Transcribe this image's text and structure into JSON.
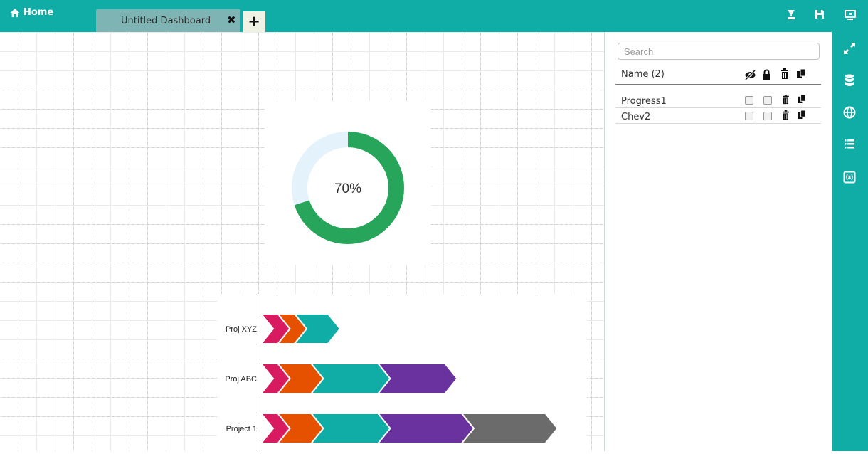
{
  "topbar": {
    "home_label": "Home",
    "tab_title": "Untitled Dashboard",
    "tab_close": "✖",
    "tab_add": "+",
    "color": "#10ada6"
  },
  "progress_widget": {
    "percent_label": "70%",
    "value": 0.7,
    "fill_color": "#27a55a",
    "track_color": "#e3f2fb"
  },
  "chevron_widget": {
    "rows": [
      {
        "label": "Proj XYZ",
        "segments": [
          {
            "color": "#d81b60",
            "size": 1
          },
          {
            "color": "#e65100",
            "size": 1
          },
          {
            "color": "#10ada6",
            "size": 2
          }
        ]
      },
      {
        "label": "Proj ABC",
        "segments": [
          {
            "color": "#d81b60",
            "size": 1
          },
          {
            "color": "#e65100",
            "size": 2
          },
          {
            "color": "#10ada6",
            "size": 4
          },
          {
            "color": "#6a329f",
            "size": 4
          }
        ]
      },
      {
        "label": "Project 1",
        "segments": [
          {
            "color": "#d81b60",
            "size": 1
          },
          {
            "color": "#e65100",
            "size": 2
          },
          {
            "color": "#10ada6",
            "size": 4
          },
          {
            "color": "#6a329f",
            "size": 5
          },
          {
            "color": "#6b6b6b",
            "size": 5
          }
        ]
      }
    ]
  },
  "panel": {
    "search_placeholder": "Search",
    "header_label": "Name (2)",
    "header_icons": [
      "eye-slash-icon",
      "lock-icon",
      "trash-icon",
      "copy-icon"
    ],
    "items": [
      {
        "name": "Progress1"
      },
      {
        "name": "Chev2"
      }
    ]
  },
  "rightbar": {
    "icons": [
      "expand-icon",
      "database-icon",
      "globe-icon",
      "list-icon",
      "variable-icon"
    ]
  }
}
